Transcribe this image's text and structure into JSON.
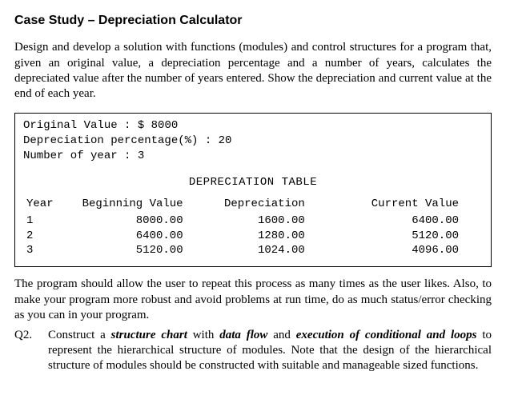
{
  "title": "Case Study – Depreciation Calculator",
  "intro": "Design and develop a solution with functions (modules) and control structures for a program that, given an original value, a depreciation percentage and a number of years, calculates the depreciated value after the number of years entered. Show the depreciation and current value at the end of each year.",
  "inputs": {
    "line1_label": "Original Value : $ ",
    "line1_value": "8000",
    "line2_label": "Depreciation percentage(%) : ",
    "line2_value": "20",
    "line3_label": "Number of year : ",
    "line3_value": "3"
  },
  "table": {
    "title": "DEPRECIATION TABLE",
    "headers": [
      "Year",
      "Beginning Value",
      "Depreciation",
      "Current Value"
    ],
    "rows": [
      [
        "1",
        "8000.00",
        "1600.00",
        "6400.00"
      ],
      [
        "2",
        "6400.00",
        "1280.00",
        "5120.00"
      ],
      [
        "3",
        "5120.00",
        "1024.00",
        "4096.00"
      ]
    ]
  },
  "para2": "The program should allow the user to repeat this process as many times as the user likes. Also, to make your program more robust and avoid problems at run time, do as much status/error checking as you can in your program.",
  "q2": {
    "label": "Q2.",
    "t1": "Construct a ",
    "t2": "structure chart",
    "t3": " with ",
    "t4": "data flow",
    "t5": " and ",
    "t6": "execution of conditional and loops",
    "t7": " to represent the hierarchical structure of modules. Note that the design of the hierarchical structure of modules should be constructed with suitable and manageable sized functions."
  }
}
